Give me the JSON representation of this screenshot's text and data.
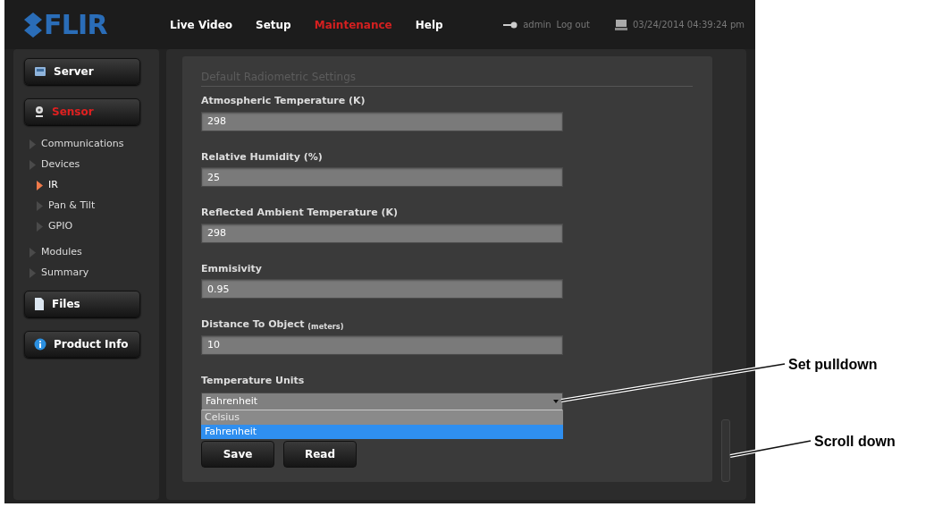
{
  "header": {
    "logo": "FLIR",
    "nav": [
      {
        "label": "Live Video",
        "selected": false
      },
      {
        "label": "Setup",
        "selected": false
      },
      {
        "label": "Maintenance",
        "selected": true
      },
      {
        "label": "Help",
        "selected": false
      }
    ],
    "user": "admin",
    "logout": "Log out",
    "datetime": "03/24/2014 04:39:24 pm"
  },
  "sidebar": {
    "buttons": [
      {
        "label": "Server",
        "selected": false
      },
      {
        "label": "Sensor",
        "selected": true,
        "children": [
          {
            "label": "Communications",
            "selected": false
          },
          {
            "label": "Devices",
            "selected": false,
            "children": [
              {
                "label": "IR",
                "selected": true
              },
              {
                "label": "Pan & Tilt",
                "selected": false
              },
              {
                "label": "GPIO",
                "selected": false
              }
            ]
          },
          {
            "label": "Modules",
            "selected": false
          },
          {
            "label": "Summary",
            "selected": false
          }
        ]
      },
      {
        "label": "Files",
        "selected": false
      },
      {
        "label": "Product Info",
        "selected": false
      }
    ]
  },
  "form": {
    "heading": "Default Radiometric Settings",
    "fields": [
      {
        "label": "Atmospheric Temperature (K)",
        "value": "298"
      },
      {
        "label": "Relative Humidity (%)",
        "value": "25"
      },
      {
        "label": "Reflected Ambient Temperature (K)",
        "value": "298"
      },
      {
        "label": "Emmisivity",
        "value": "0.95"
      },
      {
        "label": "Distance To Object $_{(meters)}$",
        "value": "10"
      }
    ],
    "dropdown": {
      "label": "Temperature Units",
      "value": "Fahrenheit",
      "expanded": true,
      "options": [
        {
          "label": "Celsius",
          "selected": false
        },
        {
          "label": "Fahrenheit",
          "selected": true
        }
      ]
    },
    "buttons": [
      "Save",
      "Read"
    ]
  },
  "callouts": [
    {
      "text": "Set pulldown"
    },
    {
      "text": "Scroll down"
    }
  ]
}
